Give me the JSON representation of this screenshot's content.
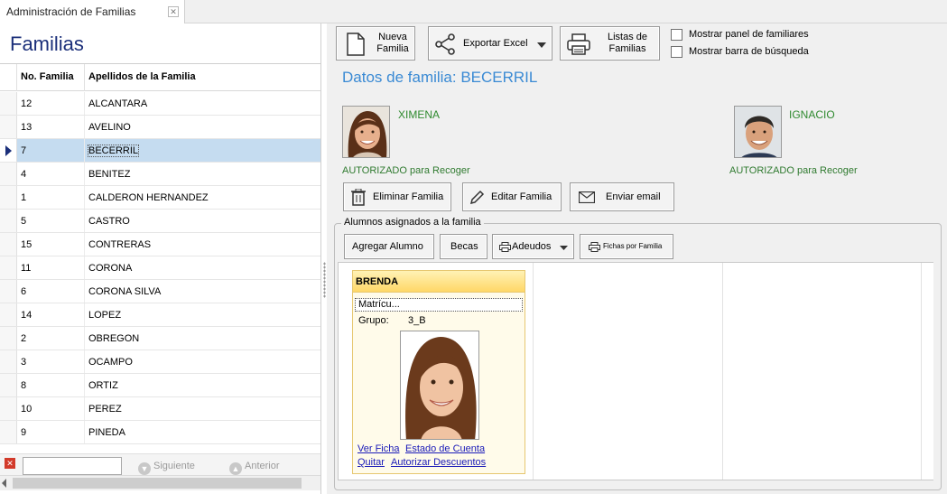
{
  "tab": {
    "title": "Administración de Familias"
  },
  "page_title": "Familias",
  "grid": {
    "columns": [
      "No. Familia",
      "Apellidos de la Familia"
    ],
    "rows": [
      {
        "no": "12",
        "name": "ALCANTARA"
      },
      {
        "no": "13",
        "name": "AVELINO"
      },
      {
        "no": "7",
        "name": "BECERRIL"
      },
      {
        "no": "4",
        "name": "BENITEZ"
      },
      {
        "no": "1",
        "name": "CALDERON HERNANDEZ"
      },
      {
        "no": "5",
        "name": "CASTRO"
      },
      {
        "no": "15",
        "name": "CONTRERAS"
      },
      {
        "no": "11",
        "name": "CORONA"
      },
      {
        "no": "6",
        "name": "CORONA SILVA"
      },
      {
        "no": "14",
        "name": "LOPEZ"
      },
      {
        "no": "2",
        "name": "OBREGON"
      },
      {
        "no": "3",
        "name": "OCAMPO"
      },
      {
        "no": "8",
        "name": "ORTIZ"
      },
      {
        "no": "10",
        "name": "PEREZ"
      },
      {
        "no": "9",
        "name": "PINEDA"
      }
    ],
    "selected_index": 2
  },
  "search": {
    "value": "",
    "next_label": "Siguiente",
    "prev_label": "Anterior"
  },
  "toolbar": {
    "new_family_label": "Nueva\nFamilia",
    "export_label": "Exportar Excel",
    "lists_label": "Listas de\nFamilias",
    "show_panel_label": "Mostrar panel de familiares",
    "show_search_label": "Mostrar barra de búsqueda"
  },
  "details": {
    "title": "Datos de familia: BECERRIL",
    "parent1": {
      "name": "XIMENA",
      "status": "AUTORIZADO para Recoger"
    },
    "parent2": {
      "name": "IGNACIO",
      "status": "AUTORIZADO para Recoger"
    },
    "delete_label": "Eliminar Familia",
    "edit_label": "Editar Familia",
    "email_label": "Enviar email"
  },
  "students": {
    "group_title": "Alumnos asignados a la familia",
    "add_label": "Agregar Alumno",
    "becas_label": "Becas",
    "adeudos_label": "Adeudos",
    "fichas_label": "Fichas por Familia",
    "card": {
      "name": "BRENDA",
      "matricula": "Matrícu...",
      "group_label": "Grupo:",
      "group_value": "3_B",
      "link_ver_ficha": "Ver Ficha",
      "link_estado": "Estado de Cuenta",
      "link_quitar": "Quitar",
      "link_descuentos": "Autorizar Descuentos"
    }
  },
  "colors": {
    "accent_blue": "#3a8ad4",
    "title_navy": "#1b2f7a",
    "authorized_green": "#2f8a2f",
    "selection": "#c5dcf0",
    "card_header": "#ffd767"
  }
}
